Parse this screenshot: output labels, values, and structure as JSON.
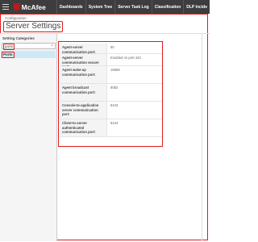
{
  "header": {
    "brand": "McAfee",
    "nav": [
      "Dashboards",
      "System Tree",
      "Server Task Log",
      "Classification",
      "DLP Incide"
    ]
  },
  "breadcrumb": "Configuration",
  "page_title": "Server Settings",
  "sidebar": {
    "heading": "Setting Categories",
    "search_value": "ports",
    "categories": [
      "Ports"
    ]
  },
  "settings": [
    {
      "label": "Agent-server communication port:",
      "value": "80"
    },
    {
      "label": "Agent-server communication secure port:",
      "value": "Enabled on port 443"
    },
    {
      "label": "Agent wake-up communication port:",
      "value": "16669"
    },
    {
      "label": "Agent broadcast communication port:",
      "value": "8082"
    },
    {
      "label": "Console-to-application server communication port:",
      "value": "8443"
    },
    {
      "label": "Client-to-server authenticated communication port:",
      "value": "8444"
    }
  ]
}
